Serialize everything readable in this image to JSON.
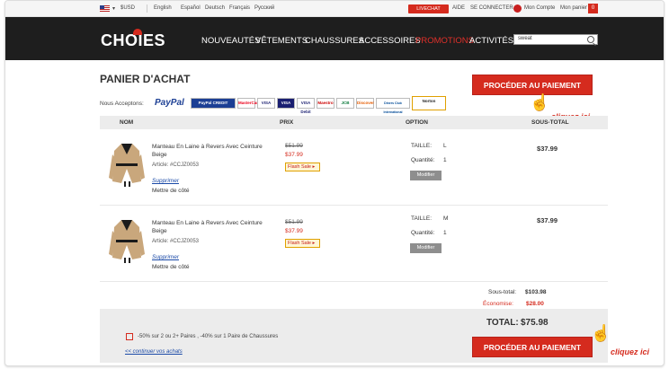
{
  "topbar": {
    "currency": "$USD",
    "languages": [
      "English",
      "Español",
      "Deutsch",
      "Français",
      "Русский"
    ],
    "livechat": "LIVECHAT",
    "help": "AIDE",
    "login": "SE CONNECTER",
    "account": "Mon Compte",
    "cart": "Mon panier",
    "cart_count": "0"
  },
  "header": {
    "logo": "CHOIES",
    "nav": [
      "NOUVEAUTÉS",
      "VÊTEMENTS",
      "CHAUSSURES",
      "ACCESSOIRES",
      "PROMOTIONS",
      "ACTIVITÉS"
    ],
    "search_value": "sweat"
  },
  "main": {
    "title": "PANIER D'ACHAT",
    "pay_button": "PROCÉDER AU PAIEMENT",
    "accept_label": "Nous Acceptons:",
    "cliquez": "cliquez ici",
    "payment_methods": [
      "PayPal",
      "PayPal CREDIT",
      "MasterCard",
      "VISA",
      "VISA Electron",
      "VISA Debit",
      "Maestro",
      "JCB",
      "Discover",
      "Diners Club International",
      "Norton"
    ],
    "columns": {
      "name": "NOM",
      "price": "PRIX",
      "option": "OPTION",
      "subtotal": "SOUS-TOTAL"
    }
  },
  "items": [
    {
      "name": "Manteau En Laine à Revers Avec Ceinture Beige",
      "ref": "Article: #CCJZ0053",
      "remove": "Supprimer",
      "save": "Mettre de côté",
      "old_price": "$51.99",
      "price": "$37.99",
      "flash": "Flash Sale ▸",
      "size_label": "TAILLE:",
      "size": "L",
      "qty_label": "Quantité:",
      "qty": "1",
      "modify": "Modifier",
      "subtotal": "$37.99"
    },
    {
      "name": "Manteau En Laine à Revers Avec Ceinture Beige",
      "ref": "Article: #CCJZ0053",
      "remove": "Supprimer",
      "save": "Mettre de côté",
      "old_price": "$51.99",
      "price": "$37.99",
      "flash": "Flash Sale ▸",
      "size_label": "TAILLE:",
      "size": "M",
      "qty_label": "Quantité:",
      "qty": "1",
      "modify": "Modifier",
      "subtotal": "$37.99"
    }
  ],
  "totals": {
    "subtotal_label": "Sous-total:",
    "subtotal": "$103.98",
    "savings_label": "Économise:",
    "savings": "$28.00",
    "total_label": "TOTAL:",
    "total": "$75.98",
    "promo": "-50% sur 2 ou 2+ Paires , -40% sur 1 Paire de Chaussures",
    "continue": "<< continuer vos achats"
  },
  "colors": {
    "accent": "#d52b1e",
    "header_bg": "#1e1e1e"
  }
}
